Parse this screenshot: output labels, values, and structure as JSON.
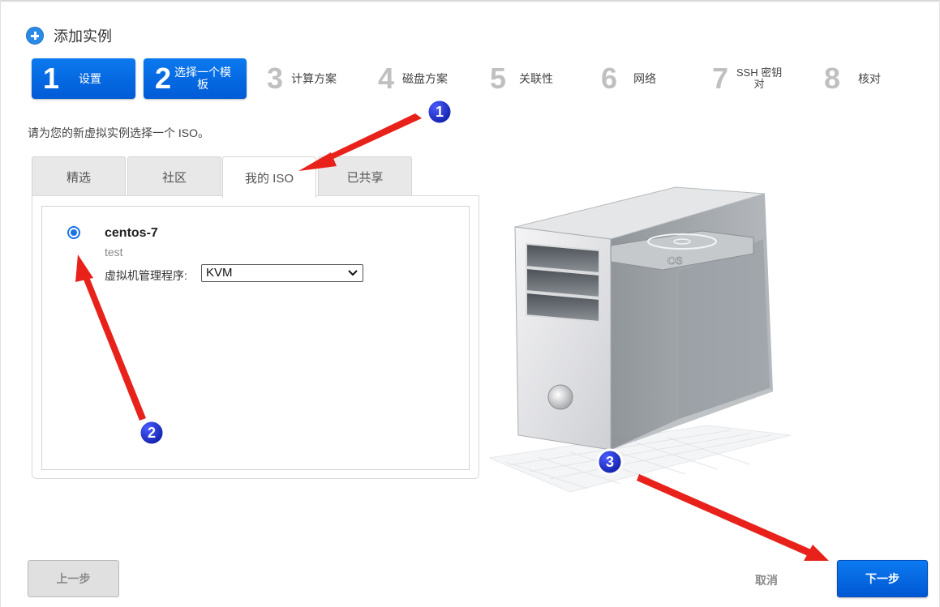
{
  "dialog": {
    "title": "添加实例",
    "icon": "plus-circle-icon"
  },
  "steps": [
    {
      "num": "1",
      "label": "设置",
      "active": true
    },
    {
      "num": "2",
      "label": "选择一个模板",
      "active": true
    },
    {
      "num": "3",
      "label": "计算方案",
      "active": false
    },
    {
      "num": "4",
      "label": "磁盘方案",
      "active": false
    },
    {
      "num": "5",
      "label": "关联性",
      "active": false
    },
    {
      "num": "6",
      "label": "网络",
      "active": false
    },
    {
      "num": "7",
      "label": "SSH 密钥对",
      "active": false
    },
    {
      "num": "8",
      "label": "核对",
      "active": false
    }
  ],
  "instruction": "请为您的新虚拟实例选择一个 ISO。",
  "tabs": [
    {
      "label": "精选",
      "active": false
    },
    {
      "label": "社区",
      "active": false
    },
    {
      "label": "我的 ISO",
      "active": true
    },
    {
      "label": "已共享",
      "active": false
    }
  ],
  "iso": {
    "selected": true,
    "name": "centos-7",
    "description": "test",
    "hypervisor_label": "虚拟机管理程序:",
    "hypervisor_value": "KVM"
  },
  "illustration": {
    "disc_label": "OS"
  },
  "footer": {
    "prev_label": "上一步",
    "cancel_label": "取消",
    "next_label": "下一步"
  },
  "annotations": [
    {
      "number": "1"
    },
    {
      "number": "2"
    },
    {
      "number": "3"
    }
  ],
  "colors": {
    "accent_blue": "#0a6fe8",
    "annotation_red": "#e8221b",
    "annotation_badge": "#0a1fb8"
  }
}
